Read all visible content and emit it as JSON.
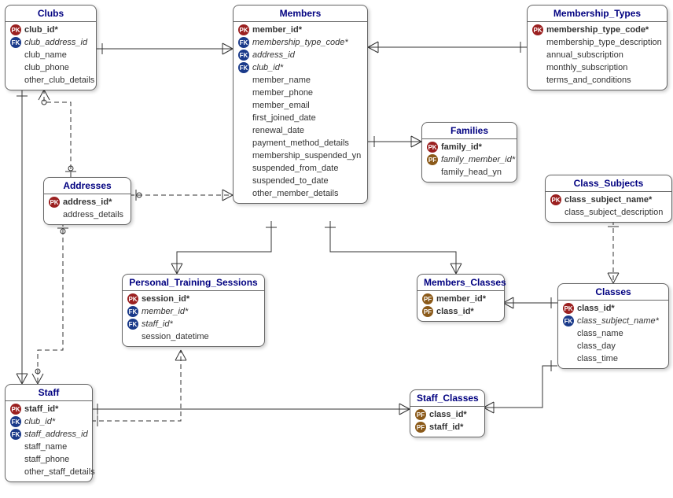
{
  "entities": {
    "clubs": {
      "title": "Clubs",
      "attrs": [
        {
          "key": "pk",
          "name": "club_id*",
          "bold": true
        },
        {
          "key": "fk",
          "name": "club_address_id",
          "italic": true
        },
        {
          "key": "",
          "name": "club_name"
        },
        {
          "key": "",
          "name": "club_phone"
        },
        {
          "key": "",
          "name": "other_club_details"
        }
      ]
    },
    "members": {
      "title": "Members",
      "attrs": [
        {
          "key": "pk",
          "name": "member_id*",
          "bold": true
        },
        {
          "key": "fk",
          "name": "membership_type_code*",
          "italic": true
        },
        {
          "key": "fk",
          "name": "address_id",
          "italic": true
        },
        {
          "key": "fk",
          "name": "club_id*",
          "italic": true
        },
        {
          "key": "",
          "name": "member_name"
        },
        {
          "key": "",
          "name": "member_phone"
        },
        {
          "key": "",
          "name": "member_email"
        },
        {
          "key": "",
          "name": "first_joined_date"
        },
        {
          "key": "",
          "name": "renewal_date"
        },
        {
          "key": "",
          "name": "payment_method_details"
        },
        {
          "key": "",
          "name": "membership_suspended_yn"
        },
        {
          "key": "",
          "name": "suspended_from_date"
        },
        {
          "key": "",
          "name": "suspended_to_date"
        },
        {
          "key": "",
          "name": "other_member_details"
        }
      ]
    },
    "membership_types": {
      "title": "Membership_Types",
      "attrs": [
        {
          "key": "pk",
          "name": "membership_type_code*",
          "bold": true
        },
        {
          "key": "",
          "name": "membership_type_description"
        },
        {
          "key": "",
          "name": "annual_subscription"
        },
        {
          "key": "",
          "name": "monthly_subscription"
        },
        {
          "key": "",
          "name": "terms_and_conditions"
        }
      ]
    },
    "families": {
      "title": "Families",
      "attrs": [
        {
          "key": "pk",
          "name": "family_id*",
          "bold": true
        },
        {
          "key": "pf",
          "name": "family_member_id*",
          "italic": true
        },
        {
          "key": "",
          "name": "family_head_yn"
        }
      ]
    },
    "addresses": {
      "title": "Addresses",
      "attrs": [
        {
          "key": "pk",
          "name": "address_id*",
          "bold": true
        },
        {
          "key": "",
          "name": "address_details"
        }
      ]
    },
    "class_subjects": {
      "title": "Class_Subjects",
      "attrs": [
        {
          "key": "pk",
          "name": "class_subject_name*",
          "bold": true
        },
        {
          "key": "",
          "name": "class_subject_description"
        }
      ]
    },
    "pts": {
      "title": "Personal_Training_Sessions",
      "attrs": [
        {
          "key": "pk",
          "name": "session_id*",
          "bold": true
        },
        {
          "key": "fk",
          "name": "member_id*",
          "italic": true
        },
        {
          "key": "fk",
          "name": "staff_id*",
          "italic": true
        },
        {
          "key": "",
          "name": "session_datetime"
        }
      ]
    },
    "members_classes": {
      "title": "Members_Classes",
      "attrs": [
        {
          "key": "pf",
          "name": "member_id*",
          "bold": true
        },
        {
          "key": "pf",
          "name": "class_id*",
          "bold": true
        }
      ]
    },
    "classes": {
      "title": "Classes",
      "attrs": [
        {
          "key": "pk",
          "name": "class_id*",
          "bold": true
        },
        {
          "key": "fk",
          "name": "class_subject_name*",
          "italic": true
        },
        {
          "key": "",
          "name": "class_name"
        },
        {
          "key": "",
          "name": "class_day"
        },
        {
          "key": "",
          "name": "class_time"
        }
      ]
    },
    "staff": {
      "title": "Staff",
      "attrs": [
        {
          "key": "pk",
          "name": "staff_id*",
          "bold": true
        },
        {
          "key": "fk",
          "name": "club_id*",
          "italic": true
        },
        {
          "key": "fk",
          "name": "staff_address_id",
          "italic": true
        },
        {
          "key": "",
          "name": "staff_name"
        },
        {
          "key": "",
          "name": "staff_phone"
        },
        {
          "key": "",
          "name": "other_staff_details"
        }
      ]
    },
    "staff_classes": {
      "title": "Staff_Classes",
      "attrs": [
        {
          "key": "pf",
          "name": "class_id*",
          "bold": true
        },
        {
          "key": "pf",
          "name": "staff_id*",
          "bold": true
        }
      ]
    }
  },
  "chart_data": {
    "type": "er-diagram",
    "entities": [
      {
        "name": "Clubs",
        "pk": [
          "club_id"
        ],
        "fk": [
          "club_address_id"
        ],
        "attrs": [
          "club_name",
          "club_phone",
          "other_club_details"
        ]
      },
      {
        "name": "Members",
        "pk": [
          "member_id"
        ],
        "fk": [
          "membership_type_code",
          "address_id",
          "club_id"
        ],
        "attrs": [
          "member_name",
          "member_phone",
          "member_email",
          "first_joined_date",
          "renewal_date",
          "payment_method_details",
          "membership_suspended_yn",
          "suspended_from_date",
          "suspended_to_date",
          "other_member_details"
        ]
      },
      {
        "name": "Membership_Types",
        "pk": [
          "membership_type_code"
        ],
        "attrs": [
          "membership_type_description",
          "annual_subscription",
          "monthly_subscription",
          "terms_and_conditions"
        ]
      },
      {
        "name": "Families",
        "pk": [
          "family_id"
        ],
        "pf": [
          "family_member_id"
        ],
        "attrs": [
          "family_head_yn"
        ]
      },
      {
        "name": "Addresses",
        "pk": [
          "address_id"
        ],
        "attrs": [
          "address_details"
        ]
      },
      {
        "name": "Class_Subjects",
        "pk": [
          "class_subject_name"
        ],
        "attrs": [
          "class_subject_description"
        ]
      },
      {
        "name": "Personal_Training_Sessions",
        "pk": [
          "session_id"
        ],
        "fk": [
          "member_id",
          "staff_id"
        ],
        "attrs": [
          "session_datetime"
        ]
      },
      {
        "name": "Members_Classes",
        "pf": [
          "member_id",
          "class_id"
        ]
      },
      {
        "name": "Classes",
        "pk": [
          "class_id"
        ],
        "fk": [
          "class_subject_name"
        ],
        "attrs": [
          "class_name",
          "class_day",
          "class_time"
        ]
      },
      {
        "name": "Staff",
        "pk": [
          "staff_id"
        ],
        "fk": [
          "club_id",
          "staff_address_id"
        ],
        "attrs": [
          "staff_name",
          "staff_phone",
          "other_staff_details"
        ]
      },
      {
        "name": "Staff_Classes",
        "pf": [
          "class_id",
          "staff_id"
        ]
      }
    ],
    "relationships": [
      {
        "from": "Clubs",
        "to": "Members",
        "type": "identifying",
        "card": "1:N"
      },
      {
        "from": "Membership_Types",
        "to": "Members",
        "type": "identifying",
        "card": "1:N"
      },
      {
        "from": "Addresses",
        "to": "Members",
        "type": "non-identifying",
        "card": "1:N"
      },
      {
        "from": "Addresses",
        "to": "Clubs",
        "type": "non-identifying",
        "card": "1:N"
      },
      {
        "from": "Addresses",
        "to": "Staff",
        "type": "non-identifying",
        "card": "1:N"
      },
      {
        "from": "Clubs",
        "to": "Staff",
        "type": "identifying",
        "card": "1:N"
      },
      {
        "from": "Members",
        "to": "Families",
        "type": "identifying",
        "card": "1:N"
      },
      {
        "from": "Members",
        "to": "Personal_Training_Sessions",
        "type": "identifying",
        "card": "1:N"
      },
      {
        "from": "Staff",
        "to": "Personal_Training_Sessions",
        "type": "identifying",
        "card": "1:N"
      },
      {
        "from": "Members",
        "to": "Members_Classes",
        "type": "identifying",
        "card": "1:N"
      },
      {
        "from": "Classes",
        "to": "Members_Classes",
        "type": "identifying",
        "card": "1:N"
      },
      {
        "from": "Class_Subjects",
        "to": "Classes",
        "type": "identifying",
        "card": "1:N"
      },
      {
        "from": "Staff",
        "to": "Staff_Classes",
        "type": "identifying",
        "card": "1:N"
      },
      {
        "from": "Classes",
        "to": "Staff_Classes",
        "type": "identifying",
        "card": "1:N"
      }
    ]
  }
}
